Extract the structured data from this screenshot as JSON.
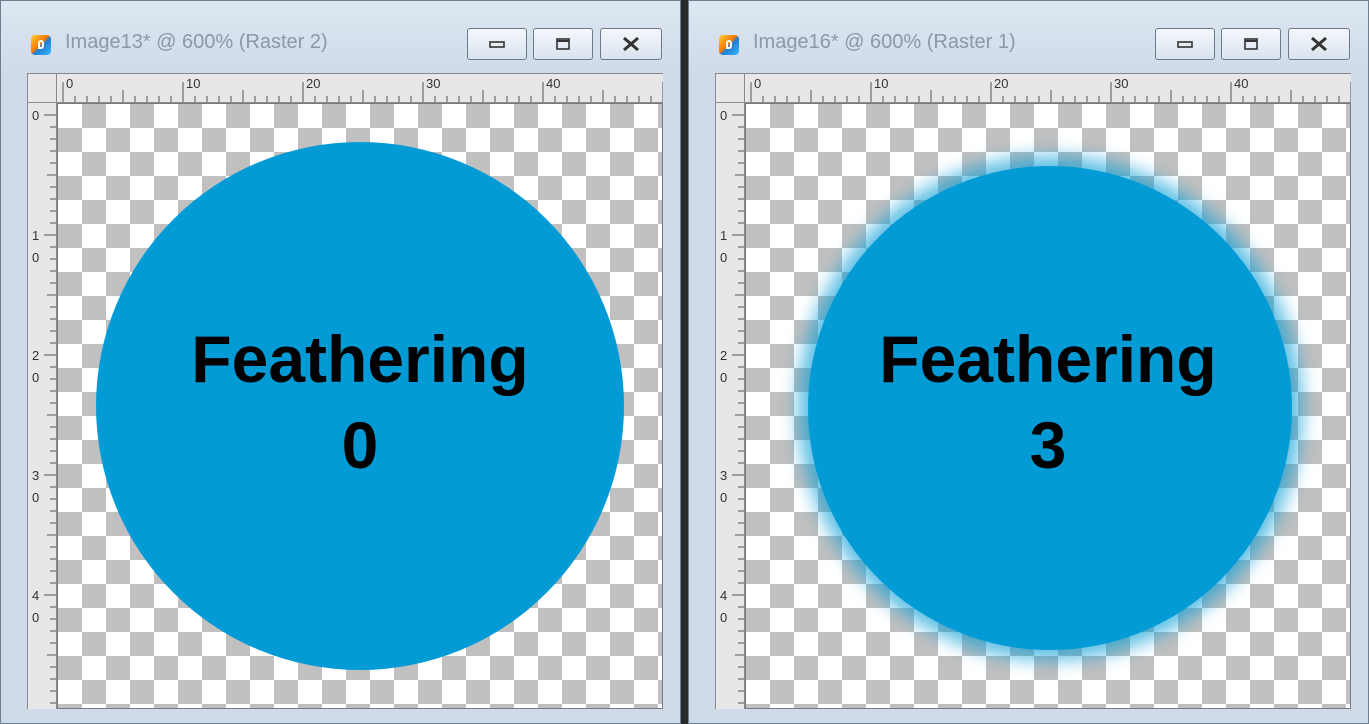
{
  "windows": [
    {
      "title": "Image13* @ 600% (Raster 2)",
      "label_line1": "Feathering",
      "label_line2": "0",
      "buttons": {
        "minimize": "minimize",
        "maximize": "maximize",
        "close": "close"
      },
      "ruler_h_labels": [
        "0",
        "10",
        "20",
        "30",
        "40"
      ],
      "ruler_v_labels": [
        "0",
        "1\n0",
        "2\n0",
        "3\n0",
        "4\n0"
      ]
    },
    {
      "title": "Image16* @ 600% (Raster 1)",
      "label_line1": "Feathering",
      "label_line2": "3",
      "buttons": {
        "minimize": "minimize",
        "maximize": "maximize",
        "close": "close"
      },
      "ruler_h_labels": [
        "0",
        "10",
        "20",
        "30",
        "40"
      ],
      "ruler_v_labels": [
        "0",
        "1\n0",
        "2\n0",
        "3\n0",
        "4\n0"
      ]
    }
  ],
  "colors": {
    "fill": "#039bd6",
    "titlebar": "#cfdbe8",
    "checker_dark": "#c0c0c0",
    "checker_light": "#ffffff"
  },
  "icons": [
    "app-icon",
    "minimize-icon",
    "maximize-icon",
    "close-icon"
  ]
}
